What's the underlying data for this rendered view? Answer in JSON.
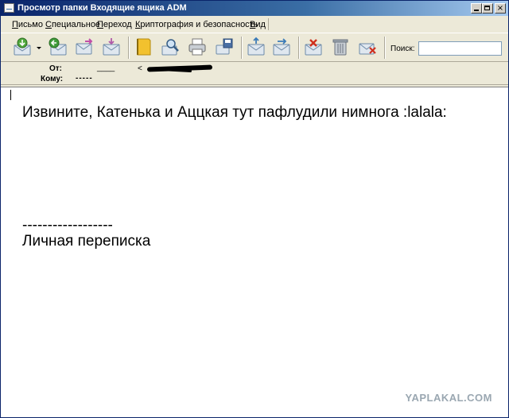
{
  "window": {
    "title": "Просмотр папки Входящие ящика ADM",
    "controls": {
      "minimize": "_",
      "maximize": "□",
      "close": "×"
    }
  },
  "menu": {
    "items": [
      "Письмо",
      "Специальное",
      "Переход",
      "Криптография и безопасность",
      "Вид"
    ]
  },
  "toolbar": {
    "icons": [
      "receive-mail-icon",
      "reply-icon",
      "forward-icon",
      "new-message-icon",
      "address-book-icon",
      "find-icon",
      "print-icon",
      "save-icon",
      "move-icon",
      "copy-icon",
      "delete-message-icon",
      "trash-icon",
      "junk-icon"
    ],
    "search_label": "Поиск:",
    "search_value": ""
  },
  "header": {
    "from_label": "От:",
    "from_value": "____",
    "from_address": "<",
    "to_label": "Кому:",
    "to_value": "-----"
  },
  "message": {
    "line1": "Извините, Катенька и Аццкая тут пафлудили нимнога :lalala:",
    "separator": "------------------",
    "signature": "Личная переписка"
  },
  "watermark": "YAPLAKAL.COM",
  "colors": {
    "title_start": "#0a246a",
    "title_end": "#a6caf0",
    "chrome": "#ece9d8"
  }
}
